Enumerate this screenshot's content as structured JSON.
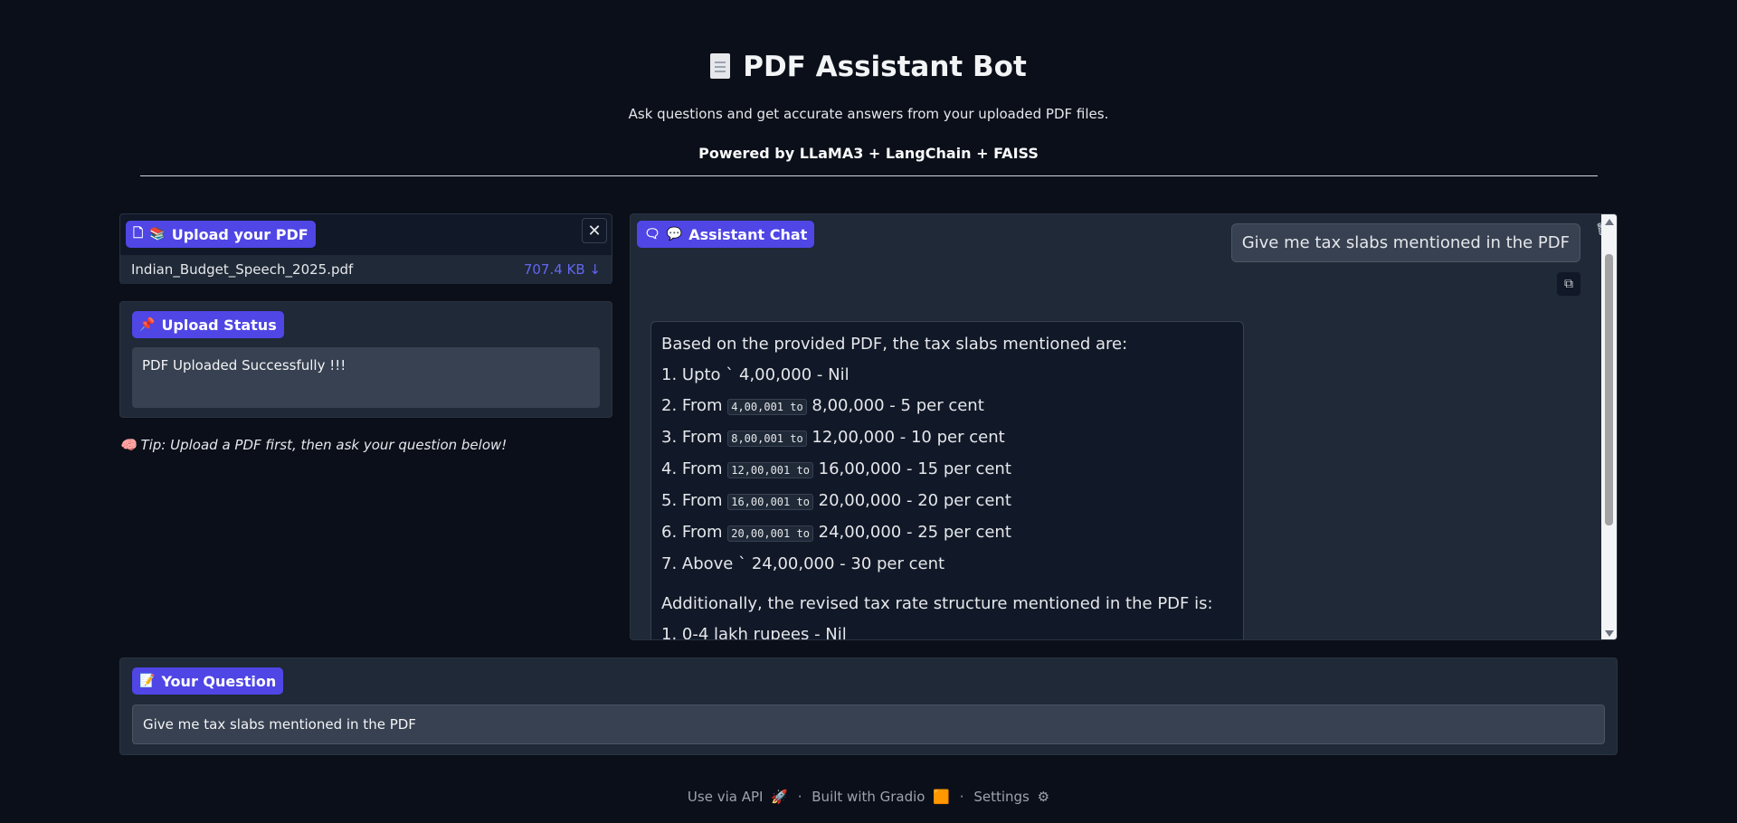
{
  "header": {
    "title": "PDF Assistant Bot",
    "subtitle": "Ask questions and get accurate answers from your uploaded PDF files.",
    "powered": "Powered by LLaMA3 + LangChain + FAISS"
  },
  "upload": {
    "label": "Upload your PDF",
    "file_name": "Indian_Budget_Speech_2025.pdf",
    "file_size": "707.4 KB ↓"
  },
  "status": {
    "label": "Upload Status",
    "value": "PDF Uploaded Successfully !!!"
  },
  "tip": "🧠 Tip: Upload a PDF first, then ask your question below!",
  "chat": {
    "label": "Assistant Chat",
    "user_message": "Give me tax slabs mentioned in the PDF",
    "bot": {
      "intro": "Based on the provided PDF, the tax slabs mentioned are:",
      "l1": "1. Upto ` 4,00,000 - Nil",
      "l2_pre": "2. From ",
      "l2_code": "4,00,001 to",
      "l2_post": " 8,00,000 - 5 per cent",
      "l3_pre": "3. From ",
      "l3_code": "8,00,001 to",
      "l3_post": " 12,00,000 - 10 per cent",
      "l4_pre": "4. From ",
      "l4_code": "12,00,001 to",
      "l4_post": " 16,00,000 - 15 per cent",
      "l5_pre": "5. From ",
      "l5_code": "16,00,001 to",
      "l5_post": " 20,00,000 - 20 per cent",
      "l6_pre": "6. From ",
      "l6_code": "20,00,001 to",
      "l6_post": " 24,00,000 - 25 per cent",
      "l7": "7. Above ` 24,00,000 - 30 per cent",
      "additional": "Additionally, the revised tax rate structure mentioned in the PDF is:",
      "a1": "1. 0-4 lakh rupees - Nil"
    }
  },
  "question": {
    "label": "Your Question",
    "value": "Give me tax slabs mentioned in the PDF"
  },
  "footer": {
    "api": "Use via API",
    "gradio": "Built with Gradio",
    "settings": "Settings",
    "sep": "·"
  }
}
